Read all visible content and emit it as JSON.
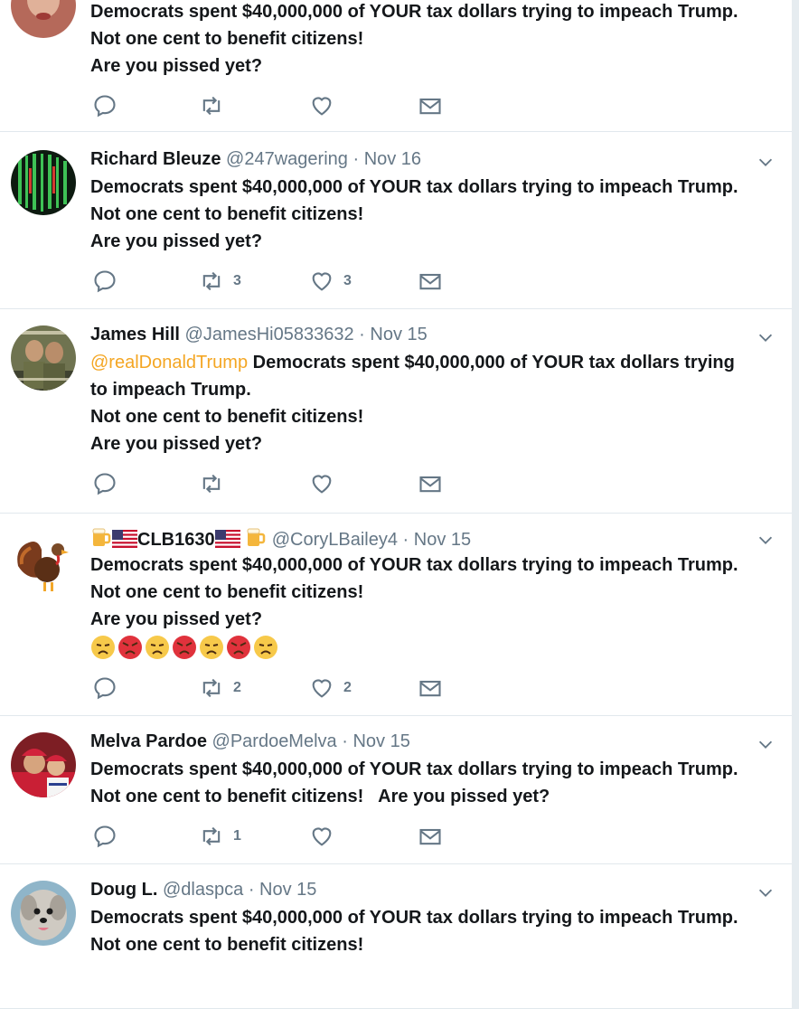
{
  "tweets": [
    {
      "name": "",
      "handle": "",
      "time": "",
      "lines": [
        "Democrats spent $40,000,000 of YOUR tax dollars trying to impeach Trump.",
        "Not one cent to benefit citizens!",
        "Are you pissed yet?"
      ],
      "retweets": "",
      "likes": ""
    },
    {
      "name": "Richard Bleuze",
      "handle": "@247wagering",
      "sep": "·",
      "time": "Nov 16",
      "lines": [
        "Democrats spent $40,000,000 of YOUR tax dollars trying to impeach Trump.",
        "Not one cent to benefit citizens!",
        "Are you pissed yet?"
      ],
      "retweets": "3",
      "likes": "3"
    },
    {
      "name": "James Hill",
      "handle": "@JamesHi05833632",
      "sep": "·",
      "time": "Nov 15",
      "mention": "@realDonaldTrump",
      "line1_after_mention": " Democrats spent $40,000,000 of YOUR tax dollars trying",
      "lines": [
        "to impeach Trump.",
        "Not one cent to benefit citizens!",
        "Are you pissed yet?"
      ],
      "retweets": "",
      "likes": ""
    },
    {
      "name": "CLB1630",
      "handle": "@CoryLBailey4",
      "sep": "·",
      "time": "Nov 15",
      "lines": [
        "Democrats spent $40,000,000 of YOUR tax dollars trying to impeach Trump.",
        "Not one cent to benefit citizens!",
        "Are you pissed yet?"
      ],
      "emojis": [
        "disappointed",
        "angry",
        "disappointed",
        "angry",
        "disappointed",
        "angry",
        "disappointed"
      ],
      "retweets": "2",
      "likes": "2"
    },
    {
      "name": "Melva Pardoe",
      "handle": "@PardoeMelva",
      "sep": "·",
      "time": "Nov 15",
      "lines": [
        "Democrats spent $40,000,000 of YOUR tax dollars trying to impeach Trump.",
        "Not one cent to benefit citizens!   Are you pissed yet?"
      ],
      "retweets": "1",
      "likes": ""
    },
    {
      "name": "Doug L.",
      "handle": "@dlaspca",
      "sep": "·",
      "time": "Nov 15",
      "lines": [
        "Democrats spent $40,000,000 of YOUR tax dollars trying to impeach Trump.",
        "Not one cent to benefit citizens!"
      ],
      "retweets": "",
      "likes": ""
    }
  ],
  "icons": {
    "reply": "reply-icon",
    "retweet": "retweet-icon",
    "like": "heart-icon",
    "dm": "envelope-icon",
    "caret": "chevron-down-icon"
  },
  "colors": {
    "text": "#14171a",
    "muted": "#657786",
    "mention": "#f4a623",
    "divider": "#e1e8ed"
  }
}
